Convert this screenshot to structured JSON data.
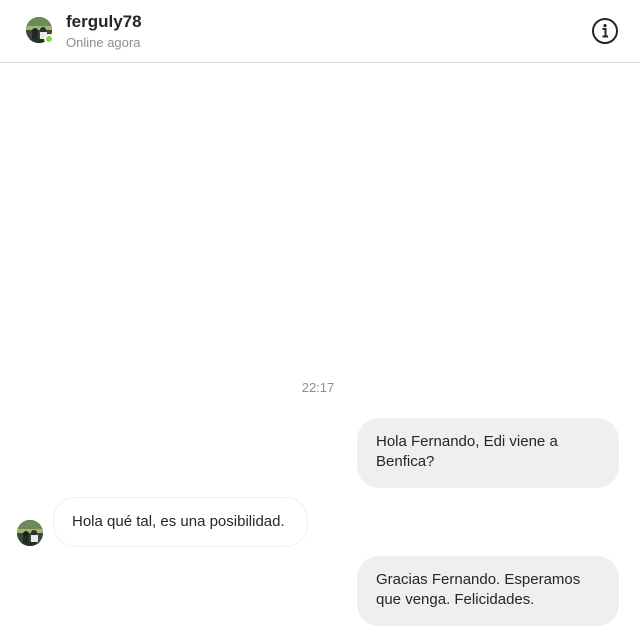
{
  "header": {
    "username": "ferguly78",
    "status": "Online agora",
    "avatar_icon": "profile-avatar",
    "online_color": "#78de45",
    "info_icon": "info-circle-icon"
  },
  "thread": {
    "timestamp": "22:17",
    "messages": [
      {
        "direction": "outgoing",
        "text": "Hola Fernando, Edi viene a Benfica?"
      },
      {
        "direction": "incoming",
        "text": "Hola qué tal, es una posibilidad."
      },
      {
        "direction": "outgoing",
        "text": "Gracias Fernando. Esperamos que venga. Felicidades."
      }
    ]
  },
  "colors": {
    "outgoing_bubble": "#efefef",
    "incoming_border": "#efefef",
    "divider": "#dbdbdb",
    "muted_text": "#8e8e8e"
  }
}
